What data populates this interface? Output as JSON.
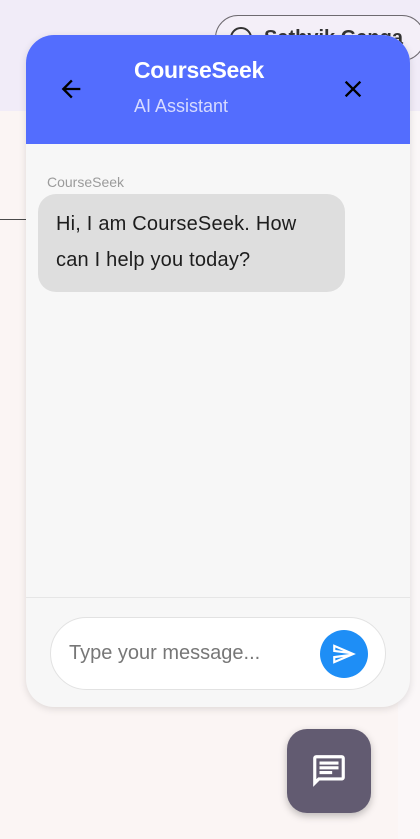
{
  "background": {
    "chip_label": "Sathvik Ganga"
  },
  "chat": {
    "title": "CourseSeek",
    "subtitle": "AI Assistant",
    "back_icon": "arrow-left-icon",
    "close_icon": "close-icon",
    "messages": [
      {
        "sender": "CourseSeek",
        "text": "Hi, I am CourseSeek. How can I help you today?"
      }
    ],
    "input": {
      "value": "",
      "placeholder": "Type your message..."
    },
    "send_icon": "send-icon"
  },
  "fab": {
    "icon": "chat-message-icon"
  },
  "colors": {
    "header": "#536dfe",
    "send_button": "#1e8ef6",
    "fab": "#625b71",
    "bubble": "#dedede"
  }
}
